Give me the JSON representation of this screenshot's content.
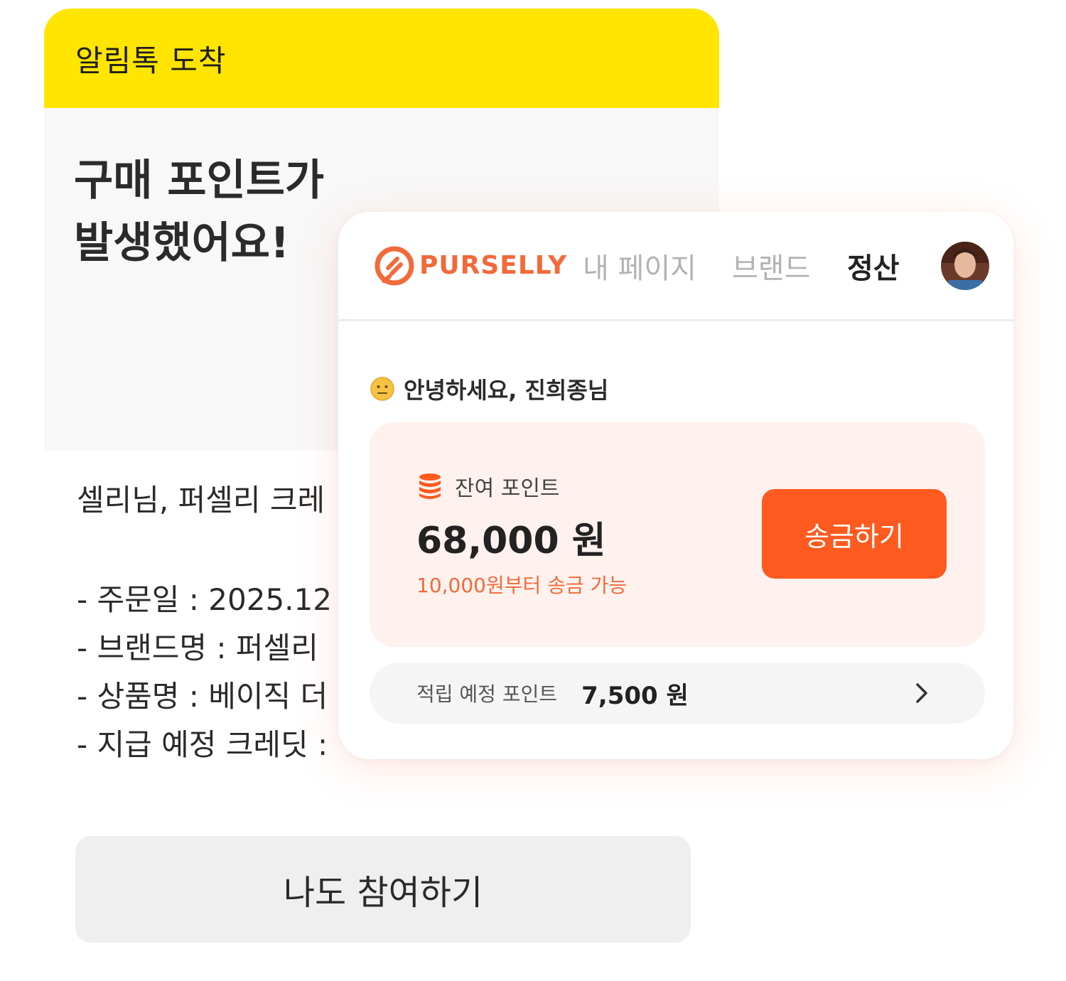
{
  "alimtalk": {
    "header_title": "알림톡 도착",
    "hero_title_line1": "구매 포인트가",
    "hero_title_line2": "발생했어요!",
    "greeting": "셀리님, 퍼셀리 크레",
    "details": [
      "- 주문일 : 2025.12",
      "- 브랜드명 : 퍼셀리",
      "- 상품명 : 베이직 더",
      "- 지급 예정 크레딧 :"
    ],
    "join_button_label": "나도 참여하기",
    "header_color": "#FFE500"
  },
  "pursally": {
    "brand_name": "PURSELLY",
    "brand_icon": "pursally-logo-icon",
    "nav": {
      "mypage": "내 페이지",
      "brand": "브랜드",
      "settlement": "정산"
    },
    "avatar_icon": "user-avatar",
    "greeting": "안녕하세요, 진희종님",
    "greeting_icon": "smiley-emoji-icon",
    "balance": {
      "label": "잔여 포인트",
      "label_icon": "coin-stack-icon",
      "amount": "68,000 원",
      "note": "10,000원부터 송금 가능",
      "send_button_label": "송금하기"
    },
    "pending": {
      "label": "적립 예정 포인트",
      "value": "7,500 원",
      "chevron_icon": "chevron-right-icon"
    },
    "accent_color": "#FF5A1F",
    "brand_color": "#F26A3A"
  }
}
